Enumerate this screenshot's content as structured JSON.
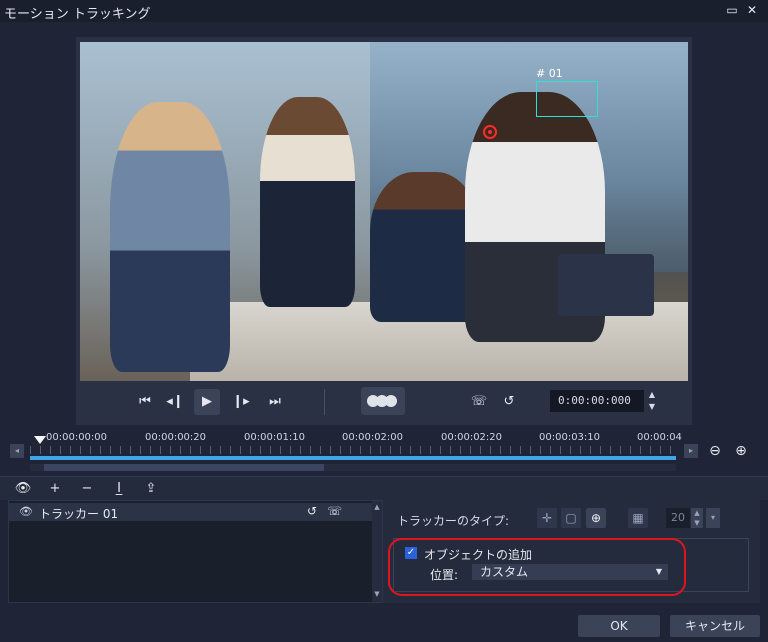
{
  "window": {
    "title": "モーション トラッキング",
    "maximize_icon": "maximize-icon",
    "close_icon": "close-icon"
  },
  "preview": {
    "tracker_label": "# 01",
    "timecode": "0:00:00:000"
  },
  "timeline": {
    "ticks": [
      "00:00:00:00",
      "00:00:00:20",
      "00:00:01:10",
      "00:00:02:00",
      "00:00:02:20",
      "00:00:03:10",
      "00:00:04"
    ]
  },
  "tracker_list": {
    "items": [
      {
        "name": "トラッカー 01"
      }
    ]
  },
  "properties": {
    "tracker_type_label": "トラッカーのタイプ:",
    "size_value": "20",
    "add_object_label": "オブジェクトの追加",
    "add_object_checked": true,
    "position_label": "位置:",
    "position_value": "カスタム"
  },
  "footer": {
    "ok_label": "OK",
    "cancel_label": "キャンセル"
  },
  "colors": {
    "background": "#1f2536",
    "tracker_box": "#2de0d8",
    "tracker_point": "#ff2a2a",
    "timeline_track": "#3fa7e6",
    "highlight": "#e0141c",
    "checkbox": "#2b62d9"
  }
}
